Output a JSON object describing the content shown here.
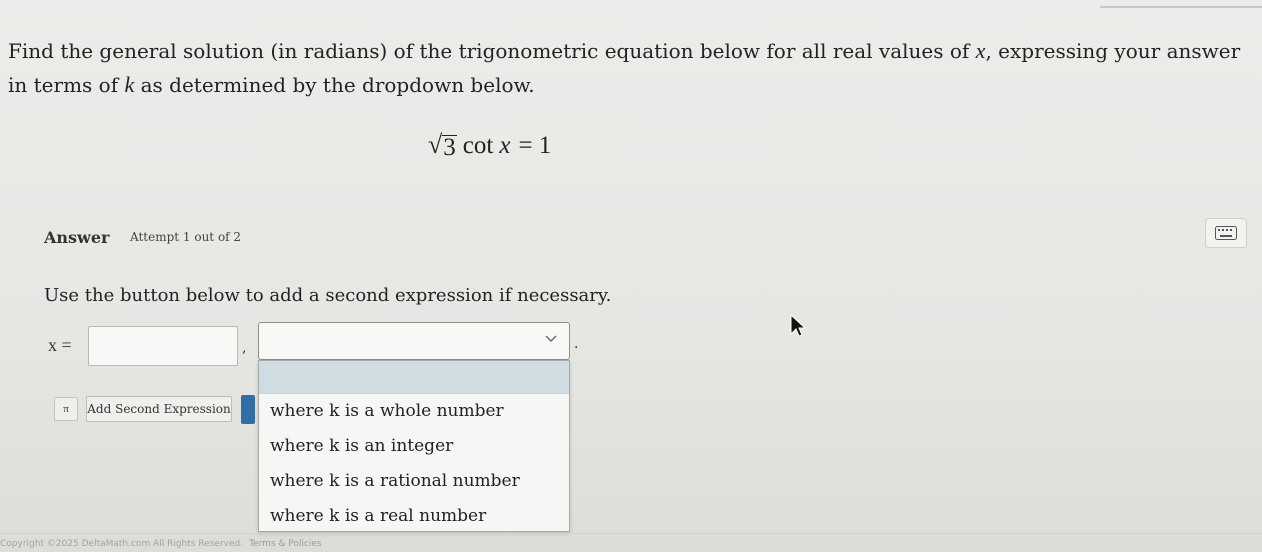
{
  "question": {
    "part1": "Find the general solution (in radians) of the trigonometric equation below for all real values of ",
    "var_x": "x",
    "part2": ", expressing your answer in terms of ",
    "var_k": "k",
    "part3": " as determined by the dropdown below."
  },
  "equation": {
    "radicand": "3",
    "function": "cot",
    "variable": "x",
    "rhs": "= 1"
  },
  "answer": {
    "label": "Answer",
    "attempt": "Attempt 1 out of 2"
  },
  "instruction": "Use the button below to add a second expression if necessary.",
  "input": {
    "x_label": "x =",
    "value": "",
    "comma": ",",
    "period": "."
  },
  "select": {
    "selected": "",
    "options": [
      "where k is a whole number",
      "where k is an integer",
      "where k is a rational number",
      "where k is a real number"
    ]
  },
  "buttons": {
    "pi": "π",
    "add_second": "Add Second Expression"
  },
  "footer": {
    "copyright": "Copyright ©2025 DeltaMath.com All Rights Reserved.",
    "terms": "Terms & Policies"
  },
  "icons": {
    "keyboard": "keyboard-icon",
    "chevron": "chevron-down-icon",
    "cursor": "mouse-cursor-icon"
  },
  "colors": {
    "focus_bar": "#2f6ea6",
    "highlight": "#cfdde3"
  }
}
